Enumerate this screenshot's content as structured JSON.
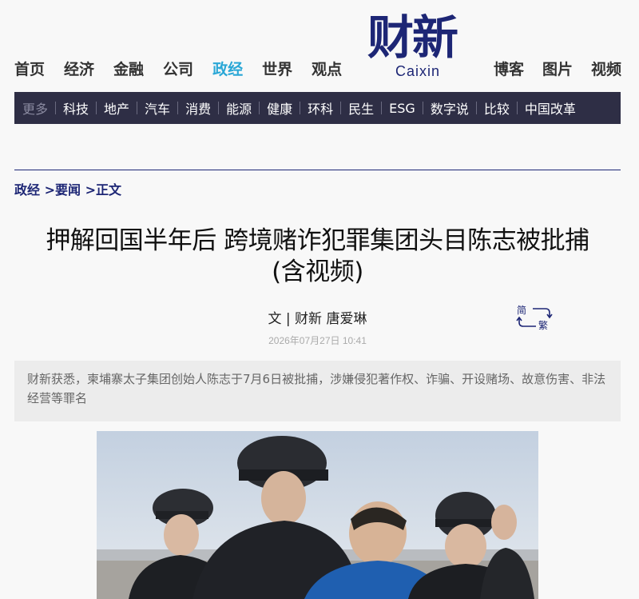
{
  "nav": {
    "left": [
      "首页",
      "经济",
      "金融",
      "公司",
      "政经",
      "世界",
      "观点"
    ],
    "active": "政经",
    "right": [
      "博客",
      "图片",
      "视频"
    ]
  },
  "logo": {
    "cn": "财新",
    "en": "Caixin"
  },
  "subnav": {
    "more": "更多",
    "items": [
      "科技",
      "地产",
      "汽车",
      "消费",
      "能源",
      "健康",
      "环科",
      "民生",
      "ESG",
      "数字说",
      "比较",
      "中国改革"
    ]
  },
  "breadcrumb": [
    "政经",
    "要闻",
    "正文"
  ],
  "article": {
    "title_line1": "押解回国半年后 跨境赌诈犯罪集团头目陈志被批捕",
    "title_line2": "(含视频)",
    "byline": "文 | 财新 唐爱琳",
    "date": "2026年07月27日 10:41",
    "summary": "财新获悉，柬埔寨太子集团创始人陈志于7月6日被批捕，涉嫌侵犯著作权、诈骗、开设赌场、故意伤害、非法经营等罪名"
  },
  "convert": {
    "simplified": "简",
    "traditional": "繁"
  },
  "colors": {
    "brand": "#1d2675",
    "active_nav": "#2aa7d6",
    "subnav_bg": "#2e2e45"
  }
}
